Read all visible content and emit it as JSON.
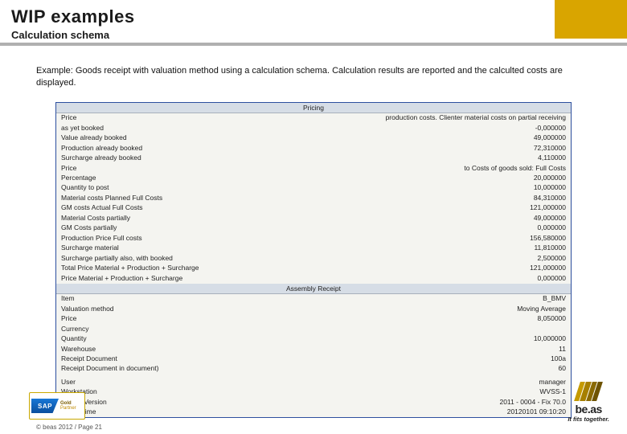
{
  "header": {
    "title": "WIP examples",
    "subtitle": "Calculation schema"
  },
  "body_text": "Example: Goods receipt with valuation method using a calculation schema. Calculation results are reported and the calculted costs are displayed.",
  "pricing": {
    "header": "Pricing",
    "note": "production costs. Clienter material costs on partial receiving",
    "rows": [
      {
        "label": "Price",
        "value": ""
      },
      {
        "label": "as yet booked",
        "value": "-0,000000"
      },
      {
        "label": "Value already booked",
        "value": "49,000000"
      },
      {
        "label": "Production already booked",
        "value": "72,310000"
      },
      {
        "label": "Surcharge already booked",
        "value": "4,110000"
      },
      {
        "label": "Price",
        "value": "to Costs of goods sold: Full Costs"
      },
      {
        "label": "Percentage",
        "value": "20,000000"
      },
      {
        "label": "Quantity to post",
        "value": "10,000000"
      },
      {
        "label": "Material costs Planned  Full Costs",
        "value": "84,310000"
      },
      {
        "label": "GM costs Actual  Full Costs",
        "value": "121,000000"
      },
      {
        "label": "Material Costs partially",
        "value": "49,000000"
      },
      {
        "label": "GM Costs partially",
        "value": "0,000000"
      },
      {
        "label": "Production Price Full costs",
        "value": "156,580000"
      },
      {
        "label": "Surcharge material",
        "value": "11,810000"
      },
      {
        "label": "Surcharge partially also, with booked",
        "value": "2,500000"
      },
      {
        "label": "Total Price Material + Production + Surcharge",
        "value": "121,000000"
      },
      {
        "label": "Price Material + Production + Surcharge",
        "value": "0,000000"
      }
    ]
  },
  "assembly": {
    "header": "Assembly Receipt",
    "rows": [
      {
        "label": "Item",
        "value": "B_BMV"
      },
      {
        "label": "Valuation method",
        "value": "Moving Average"
      },
      {
        "label": "Price",
        "value": "8,050000"
      },
      {
        "label": "Currency",
        "value": ""
      },
      {
        "label": "Quantity",
        "value": "10,000000"
      },
      {
        "label": "Warehouse",
        "value": "11"
      },
      {
        "label": "Receipt Document",
        "value": "100a"
      },
      {
        "label": "Receipt Document  in document)",
        "value": "60"
      }
    ],
    "meta": [
      {
        "label": "User",
        "value": "manager"
      },
      {
        "label": "Workstation",
        "value": "WVSS-1"
      },
      {
        "label": "be.as - Version",
        "value": "2011 - 0004 - Fix 70.0"
      },
      {
        "label": "Date / Time",
        "value": "20120101 09:10:20"
      }
    ]
  },
  "footer": {
    "sap": "SAP",
    "partner_line1": "Gold",
    "partner_line2": "Partner",
    "copyright": "© beas 2012 / Page 21",
    "beas_brand": "be.as",
    "beas_tag": "It fits together."
  }
}
